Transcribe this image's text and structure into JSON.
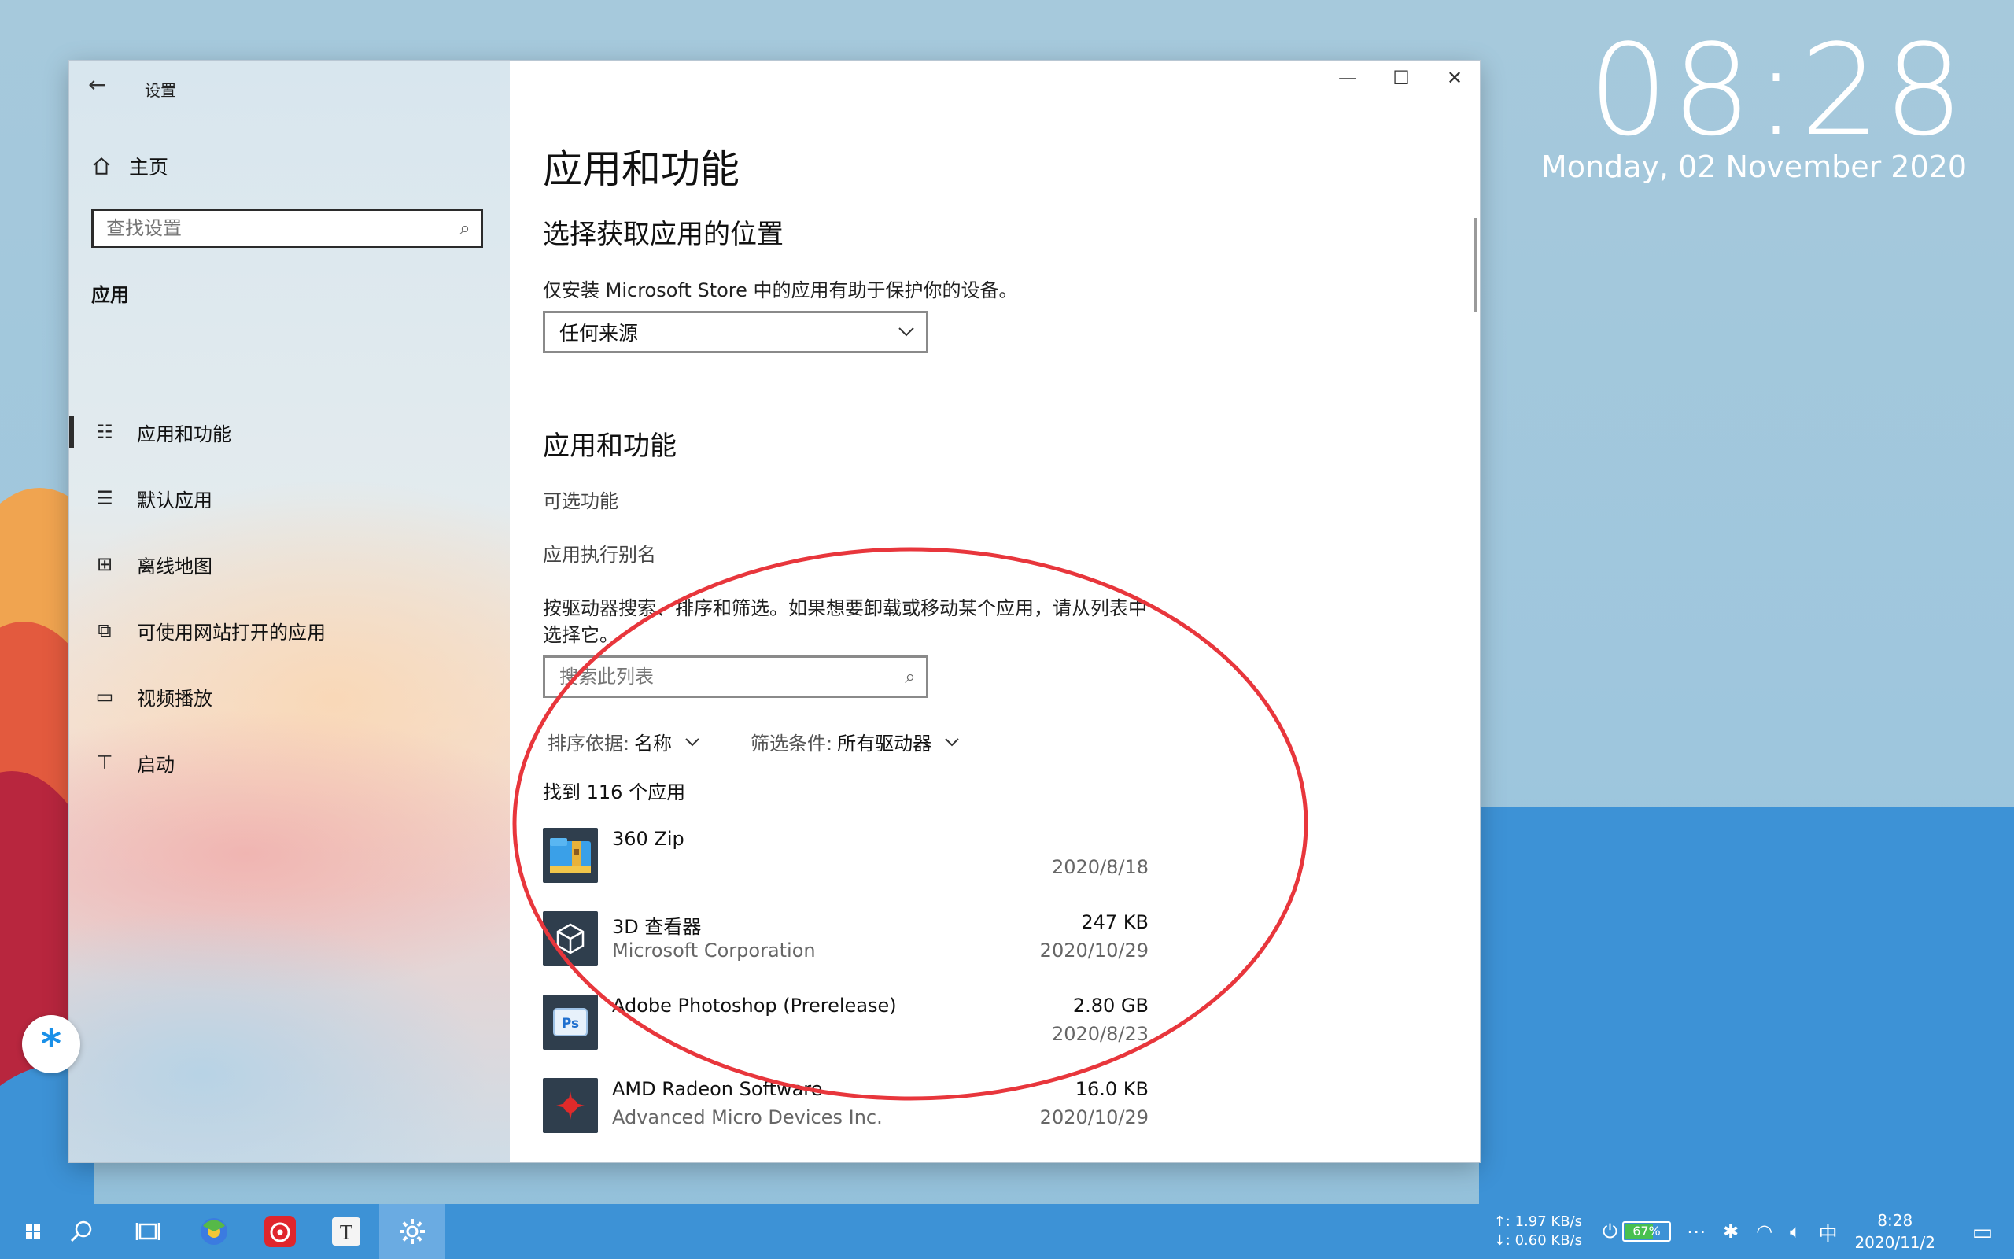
{
  "desktop": {
    "clock_time": "08:28",
    "clock_date": "Monday, 02 November 2020"
  },
  "window": {
    "title": "设置",
    "controls": {
      "minimize": "—",
      "maximize": "☐",
      "close": "✕"
    }
  },
  "sidebar": {
    "home": "主页",
    "search_placeholder": "查找设置",
    "section": "应用",
    "items": [
      {
        "label": "应用和功能",
        "icon": "apps-list-icon",
        "active": true
      },
      {
        "label": "默认应用",
        "icon": "default-apps-icon",
        "active": false
      },
      {
        "label": "离线地图",
        "icon": "map-icon",
        "active": false
      },
      {
        "label": "可使用网站打开的应用",
        "icon": "open-with-icon",
        "active": false
      },
      {
        "label": "视频播放",
        "icon": "video-icon",
        "active": false
      },
      {
        "label": "启动",
        "icon": "startup-icon",
        "active": false
      }
    ]
  },
  "main": {
    "title": "应用和功能",
    "source_heading": "选择获取应用的位置",
    "source_desc": "仅安装 Microsoft Store 中的应用有助于保护你的设备。",
    "source_value": "任何来源",
    "apps_heading": "应用和功能",
    "link_optional": "可选功能",
    "link_alias": "应用执行别名",
    "list_desc_1": "按驱动器搜索、排序和筛选。如果想要卸载或移动某个应用，请从列表中",
    "list_desc_2": "选择它。",
    "list_search_placeholder": "搜索此列表",
    "sort_label": "排序依据:",
    "sort_value": "名称",
    "filter_label": "筛选条件:",
    "filter_value": "所有驱动器",
    "found": "找到 116 个应用",
    "apps": [
      {
        "name": "360 Zip",
        "publisher": "",
        "size": "",
        "date": "2020/8/18"
      },
      {
        "name": "3D 查看器",
        "publisher": "Microsoft Corporation",
        "size": "247 KB",
        "date": "2020/10/29"
      },
      {
        "name": "Adobe Photoshop (Prerelease)",
        "publisher": "",
        "size": "2.80 GB",
        "date": "2020/8/23"
      },
      {
        "name": "AMD Radeon Software",
        "publisher": "Advanced Micro Devices Inc.",
        "size": "16.0 KB",
        "date": "2020/10/29"
      }
    ]
  },
  "taskbar": {
    "net_up": "↑: 1.97 KB/s",
    "net_down": "↓: 0.60 KB/s",
    "battery": "67%",
    "battery_level": 0.67,
    "ime": "中",
    "time": "8:28",
    "date": "2020/11/2"
  },
  "colors": {
    "accent": "#3d92d6",
    "annotation": "#e8363c"
  }
}
